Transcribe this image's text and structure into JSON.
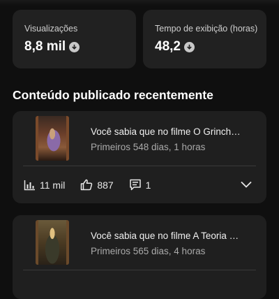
{
  "stats": [
    {
      "label": "Visualizações",
      "value": "8,8 mil",
      "trend_icon": "down-arrow-icon"
    },
    {
      "label": "Tempo de exibição (horas)",
      "value": "48,2",
      "trend_icon": "down-arrow-icon"
    }
  ],
  "section_title": "Conteúdo publicado recentemente",
  "videos": [
    {
      "title": "Você sabia que no filme O Grinch…",
      "meta": "Primeiros 548 dias, 1 horas",
      "views": "11 mil",
      "likes": "887",
      "comments": "1"
    },
    {
      "title": "Você sabia que no filme A Teoria …",
      "meta": "Primeiros 565 dias, 4 horas"
    }
  ],
  "icons": {
    "views": "bar-chart-icon",
    "likes": "thumbs-up-icon",
    "comments": "comment-icon",
    "expand": "chevron-down-icon"
  },
  "colors": {
    "background": "#0f0f0f",
    "card": "#212121",
    "text_primary": "#f1f1f1",
    "text_secondary": "#aaaaaa"
  }
}
